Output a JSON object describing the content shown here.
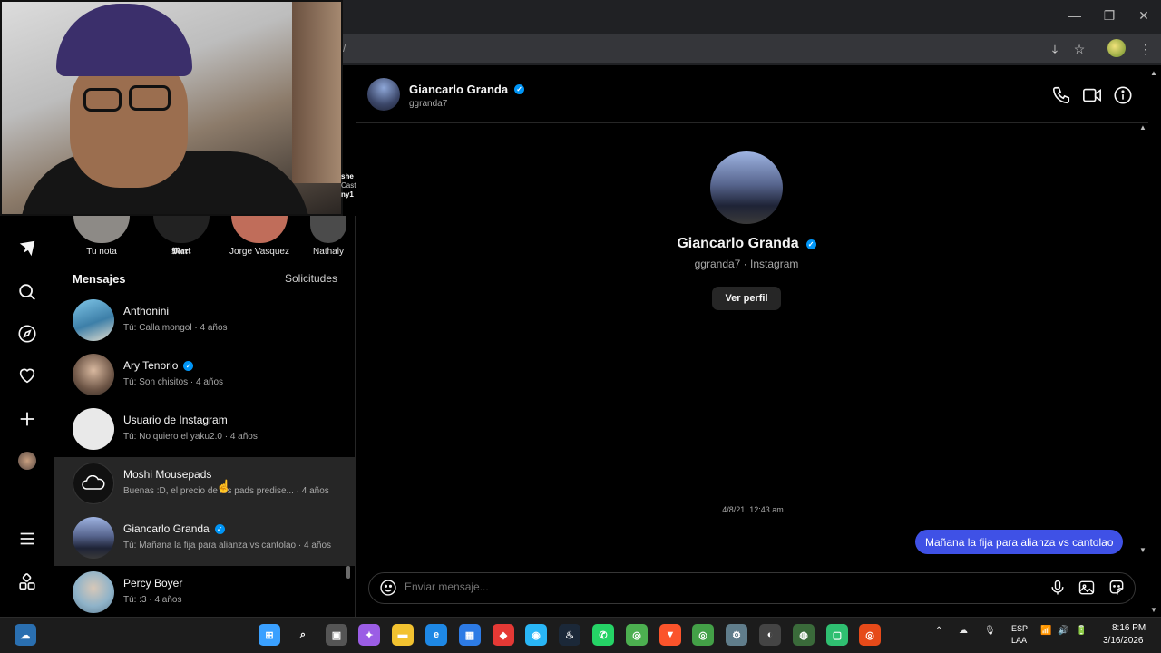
{
  "browser": {
    "url_fragment": "/",
    "window_controls": [
      "—",
      "❐",
      "✕"
    ]
  },
  "notes": [
    {
      "label": "Tu nota",
      "color": "#8d8a86"
    },
    {
      "label": "𝕸𝖆𝖗𝖎",
      "color": "#222222"
    },
    {
      "label": "Jorge Vasquez",
      "color": "#c06d5a"
    },
    {
      "label": "Nathaly",
      "color": "#4b4b4b"
    }
  ],
  "webcam_overlay_text": [
    "she",
    "Cast",
    "ny1"
  ],
  "sidebar": {
    "icons": [
      "threads-icon",
      "search-icon",
      "compass-icon",
      "heart-icon",
      "plus-icon",
      "profile-avatar",
      "menu-icon",
      "apps-icon"
    ]
  },
  "messages_list": {
    "title": "Mensajes",
    "requests_label": "Solicitudes",
    "items": [
      {
        "name": "Anthonini",
        "preview": "Tú: Calla mongol · 4 años",
        "verified": false,
        "avatar_color": "#5aa0c8"
      },
      {
        "name": "Ary Tenorio",
        "preview": "Tú: Son chisitos · 4 años",
        "verified": true,
        "avatar_color": "#b48a6e"
      },
      {
        "name": "Usuario de Instagram",
        "preview": "Tú: No quiero el yaku2.0 · 4 años",
        "verified": false,
        "avatar_color": "#e9e9e9"
      },
      {
        "name": "Moshi Mousepads",
        "preview": "Buenas :D, el precio de los pads predise...  · 4 años",
        "verified": false,
        "avatar_color": "#111111"
      },
      {
        "name": "Giancarlo Granda",
        "preview": "Tú: Mañana la fija para alianza vs cantolao · 4 años",
        "verified": true,
        "avatar_color": "#3d4a6e"
      },
      {
        "name": "Percy Boyer",
        "preview": "Tú: :3 · 4 años",
        "verified": false,
        "avatar_color": "#8fb3c9"
      }
    ]
  },
  "chat": {
    "name": "Giancarlo Granda",
    "username": "ggranda7",
    "profile_subtitle": "ggranda7 · Instagram",
    "view_profile_label": "Ver perfil",
    "timestamp": "4/8/21, 12:43 am",
    "messages": [
      {
        "from": "me",
        "text": "Mañana la fija para alianza vs cantolao"
      }
    ],
    "composer_placeholder": "Enviar mensaje...",
    "accent_color": "#3f51e6",
    "verified_color": "#0095f6"
  },
  "taskbar": {
    "apps": [
      {
        "name": "windows-start",
        "color": "#3aa0ff",
        "glyph": "⊞"
      },
      {
        "name": "search",
        "color": "#1c1c1c",
        "glyph": "⌕"
      },
      {
        "name": "task-view",
        "color": "#555555",
        "glyph": "▣"
      },
      {
        "name": "copilot",
        "color": "#9b5de5",
        "glyph": "✦"
      },
      {
        "name": "file-explorer",
        "color": "#f2c230",
        "glyph": "▬"
      },
      {
        "name": "edge",
        "color": "#1e88e5",
        "glyph": "e"
      },
      {
        "name": "store",
        "color": "#2d7be5",
        "glyph": "▦"
      },
      {
        "name": "app-red",
        "color": "#e53935",
        "glyph": "◆"
      },
      {
        "name": "app-blue",
        "color": "#29b6f6",
        "glyph": "◉"
      },
      {
        "name": "steam",
        "color": "#1b2838",
        "glyph": "♨"
      },
      {
        "name": "whatsapp",
        "color": "#25d366",
        "glyph": "✆"
      },
      {
        "name": "chrome-active",
        "color": "#4caf50",
        "glyph": "◎"
      },
      {
        "name": "brave",
        "color": "#fb542b",
        "glyph": "▼"
      },
      {
        "name": "chrome",
        "color": "#43a047",
        "glyph": "◎"
      },
      {
        "name": "settings",
        "color": "#607d8b",
        "glyph": "⚙"
      },
      {
        "name": "app-spin",
        "color": "#444444",
        "glyph": "◐"
      },
      {
        "name": "app-globe",
        "color": "#3a6a3a",
        "glyph": "◍"
      },
      {
        "name": "app-green",
        "color": "#2fbf71",
        "glyph": "▢"
      },
      {
        "name": "chrome-2",
        "color": "#e64a19",
        "glyph": "◎"
      }
    ],
    "tray_lang_1": "ESP",
    "tray_lang_2": "LAA",
    "time": "8:16 PM",
    "date": "3/16/2026"
  }
}
